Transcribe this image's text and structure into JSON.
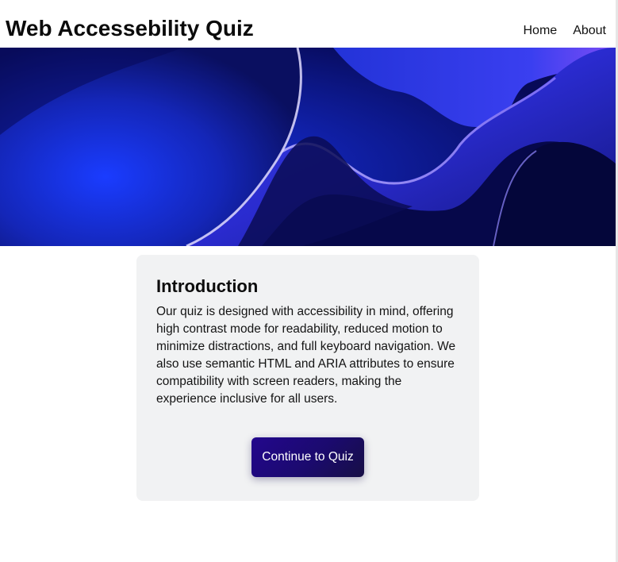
{
  "header": {
    "title": "Web Accessebility Quiz",
    "nav": [
      {
        "label": "Home"
      },
      {
        "label": "About"
      }
    ]
  },
  "hero": {
    "image": "abstract-blue-wave-banner",
    "colors": {
      "deep": "#070a58",
      "royal": "#1633e6",
      "violet": "#6b4bff",
      "highlight": "#b8b4ff"
    }
  },
  "intro": {
    "heading": "Introduction",
    "body": "Our quiz is designed with accessibility in mind, offering high contrast mode for readability, reduced motion to minimize distractions, and full keyboard navigation. We also use semantic HTML and ARIA attributes to ensure compatibility with screen readers, making the experience inclusive for all users.",
    "button_label": "Continue to Quiz"
  },
  "colors": {
    "card_background": "#f1f2f3",
    "button_start": "#23078d",
    "button_end": "#170f45",
    "button_text": "#ffffff"
  }
}
